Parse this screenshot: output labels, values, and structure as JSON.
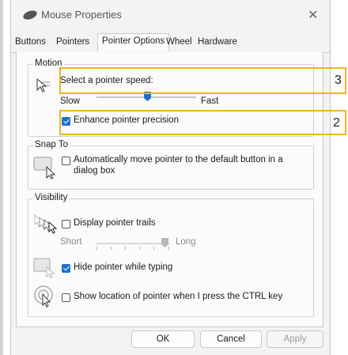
{
  "window": {
    "title": "Mouse Properties"
  },
  "tabs": [
    {
      "label": "Buttons"
    },
    {
      "label": "Pointers"
    },
    {
      "label": "Pointer Options"
    },
    {
      "label": "Wheel"
    },
    {
      "label": "Hardware"
    }
  ],
  "motion": {
    "group_label": "Motion",
    "speed_label": "Select a pointer speed:",
    "slow_label": "Slow",
    "fast_label": "Fast",
    "speed_position": 0.45,
    "precision_label": "Enhance pointer precision",
    "precision_checked": true
  },
  "snap_to": {
    "group_label": "Snap To",
    "option_line1": "Automatically move pointer to the default button in a",
    "option_line2": "dialog box",
    "checked": false
  },
  "visibility": {
    "group_label": "Visibility",
    "trails_label": "Display pointer trails",
    "trails_checked": false,
    "short_label": "Short",
    "long_label": "Long",
    "hide_label": "Hide pointer while typing",
    "hide_checked": true,
    "ctrl_label": "Show location of pointer when I press the CTRL key",
    "ctrl_checked": false
  },
  "buttons": {
    "ok": "OK",
    "cancel": "Cancel",
    "apply": "Apply"
  },
  "callouts": [
    {
      "number": "3"
    },
    {
      "number": "2"
    }
  ],
  "colors": {
    "accent": "#1d6fd1",
    "callout": "#f0b41e"
  }
}
